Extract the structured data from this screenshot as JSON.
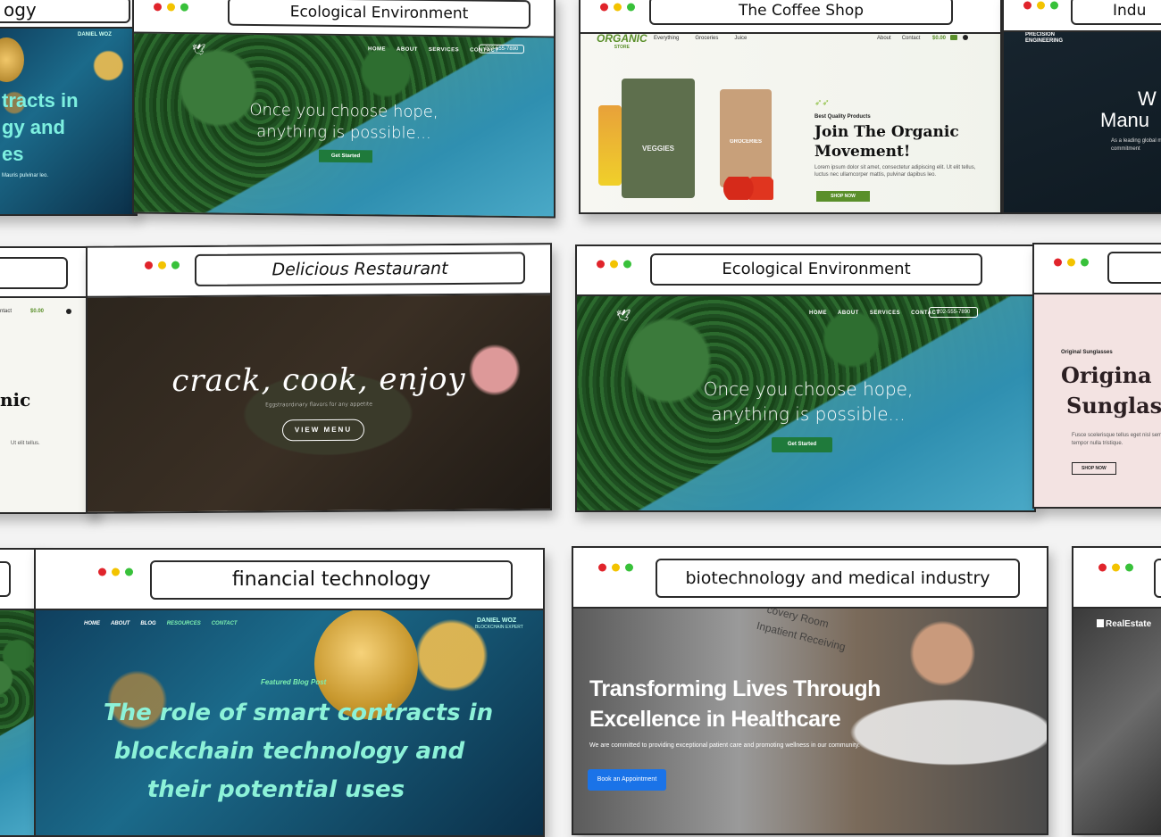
{
  "cards": {
    "eco_top": {
      "title": "Ecological Environment",
      "nav": [
        "HOME",
        "ABOUT",
        "SERVICES",
        "CONTACT"
      ],
      "phone": "202-555-7890",
      "headline_1": "Once you choose hope,",
      "headline_2": "anything is possible...",
      "cta": "Get Started"
    },
    "coffee": {
      "title": "The Coffee Shop",
      "logo": "ORGANIC",
      "logo_sub": "STORE",
      "nav": [
        "Everything",
        "Groceries",
        "Juice"
      ],
      "nav_right": [
        "About",
        "Contact"
      ],
      "cart": "$0.00",
      "bag1_label": "VEGGIES",
      "bag2_label": "GROCERIES",
      "eyebrow": "Best Quality Products",
      "headline_1": "Join The Organic",
      "headline_2": "Movement!",
      "body": "Lorem ipsum dolor sit amet, consectetur adipiscing elit. Ut elit tellus, luctus nec ullamcorper mattis, pulvinar dapibus leo.",
      "cta": "SHOP NOW"
    },
    "industry": {
      "title": "Indu",
      "brand": "PRECISION ENGINEERING",
      "headline_1": "W",
      "headline_2": "Manu",
      "body": "As a leading global m our commitment"
    },
    "crypto_top": {
      "title": "ogy",
      "author": "DANIEL WOZ",
      "headline_1": "tracts in",
      "headline_2": "gy and",
      "headline_3": "es",
      "footnote": "Mauris pulvinar leo."
    },
    "partial_left_mid": {
      "nav_contact": "ntact",
      "cart": "$0.00",
      "word": "nic",
      "body": "Ut elit tellus."
    },
    "restaurant": {
      "title": "Delicious Restaurant",
      "headline": "crack, cook, enjoy",
      "tagline": "Eggstraordinary flavors for any appetite",
      "cta": "VIEW MENU"
    },
    "eco_mid": {
      "title": "Ecological Environment",
      "nav": [
        "HOME",
        "ABOUT",
        "SERVICES",
        "CONTACT"
      ],
      "phone": "202-555-7890",
      "headline_1": "Once you choose hope,",
      "headline_2": "anything is possible...",
      "cta": "Get Started"
    },
    "sunglasses": {
      "eyebrow": "Original Sunglasses",
      "headline_1": "Origina",
      "headline_2": "Sunglas",
      "body": "Fusce scelerisque tellus eget nisl semper tempor nulla tristique.",
      "cta": "SHOP NOW"
    },
    "fintech": {
      "title": "financial technology",
      "nav": [
        "HOME",
        "ABOUT",
        "BLOG",
        "RESOURCES",
        "CONTACT"
      ],
      "author": "DANIEL WOZ",
      "author_sub": "BLOCKCHAIN EXPERT",
      "eyebrow": "Featured Blog Post",
      "headline_1": "The role of smart contracts in",
      "headline_2": "blockchain technology and",
      "headline_3": "their potential uses"
    },
    "biotech": {
      "title": "biotechnology and medical industry",
      "sign_1": "covery Room",
      "sign_2": "Inpatient Receiving",
      "headline_1": "Transforming Lives Through",
      "headline_2": "Excellence in Healthcare",
      "body": "We are committed to providing exceptional patient care and promoting wellness in our community.",
      "cta": "Book an Appointment"
    },
    "realestate": {
      "brand": "RealEstate"
    }
  }
}
